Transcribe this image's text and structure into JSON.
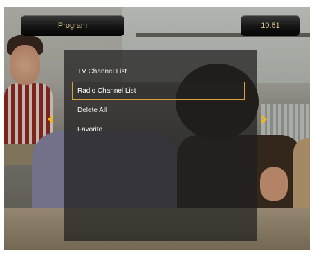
{
  "header": {
    "title": "Program",
    "time": "10:51"
  },
  "menu": {
    "items": [
      {
        "label": "TV Channel List",
        "selected": false
      },
      {
        "label": "Radio Channel List",
        "selected": true
      },
      {
        "label": "Delete All",
        "selected": false
      },
      {
        "label": "Favorite",
        "selected": false
      }
    ]
  },
  "navigation": {
    "left_icon": "double-chevron-left-icon",
    "right_icon": "double-chevron-right-icon",
    "left_glyph": "‹‹",
    "right_glyph": "››"
  },
  "colors": {
    "accent": "#f2b818",
    "selection_border": "#d8a23a",
    "header_text": "#d8c088"
  }
}
